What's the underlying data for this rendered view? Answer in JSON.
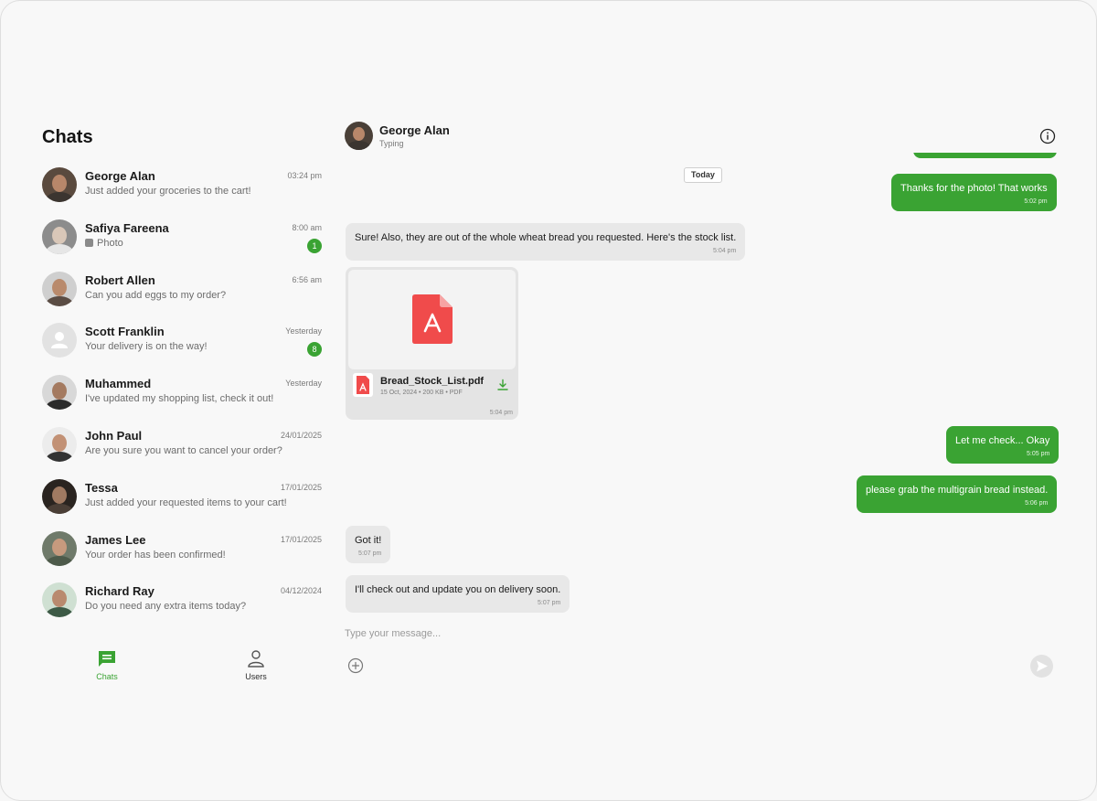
{
  "sidebar": {
    "title": "Chats",
    "chats": [
      {
        "name": "George Alan",
        "preview": "Just added your groceries to the cart!",
        "time": "03:24 pm"
      },
      {
        "name": "Safiya Fareena",
        "preview": "Photo",
        "time": "8:00 am",
        "unread": "1"
      },
      {
        "name": "Robert Allen",
        "preview": "Can you add eggs to my order?",
        "time": "6:56 am"
      },
      {
        "name": "Scott Franklin",
        "preview": "Your delivery is on the way!",
        "time": "Yesterday",
        "unread": "8"
      },
      {
        "name": "Muhammed",
        "preview": "I've updated my shopping list, check it out!",
        "time": "Yesterday"
      },
      {
        "name": "John Paul",
        "preview": "Are you sure you want to cancel your order?",
        "time": "24/01/2025"
      },
      {
        "name": "Tessa",
        "preview": "Just added your requested items to your cart!",
        "time": "17/01/2025"
      },
      {
        "name": "James Lee",
        "preview": "Your order has been confirmed!",
        "time": "17/01/2025"
      },
      {
        "name": "Richard Ray",
        "preview": "Do you need any extra items today?",
        "time": "04/12/2024"
      }
    ],
    "nav": {
      "chats_label": "Chats",
      "users_label": "Users"
    }
  },
  "conversation": {
    "contact_name": "George Alan",
    "contact_status": "Typing",
    "date_divider": "Today",
    "messages": [
      {
        "direction": "out",
        "text": "Thanks for the photo! That works",
        "time": "5:02 pm"
      },
      {
        "direction": "in",
        "text": "Sure! Also, they are out of the whole wheat bread you requested. Here's the stock list.",
        "time": "5:04 pm"
      },
      {
        "direction": "in",
        "type": "file",
        "file_name": "Bread_Stock_List.pdf",
        "file_meta": "15 Oct, 2024 • 200 KB • PDF",
        "time": "5:04 pm"
      },
      {
        "direction": "out",
        "text": "Let me check... Okay",
        "time": "5:05 pm"
      },
      {
        "direction": "out",
        "text": "please grab the multigrain bread instead.",
        "time": "5:06 pm"
      },
      {
        "direction": "in",
        "text": "Got it!",
        "time": "5:07 pm"
      },
      {
        "direction": "in",
        "text": "I'll check out and update you on delivery soon.",
        "time": "5:07 pm"
      }
    ]
  },
  "composer": {
    "placeholder": "Type your message..."
  },
  "colors": {
    "accent": "#3aa333",
    "incoming_bubble": "#e8e8e8",
    "pdf_red": "#f04b4b",
    "background": "#f8f8f8"
  },
  "icons": {
    "info": "info-icon",
    "attach": "plus-circle-icon",
    "send": "send-icon",
    "download": "download-icon",
    "pdf": "pdf-icon",
    "chats_nav": "chat-bubble-icon",
    "users_nav": "user-icon",
    "photo": "image-icon"
  }
}
